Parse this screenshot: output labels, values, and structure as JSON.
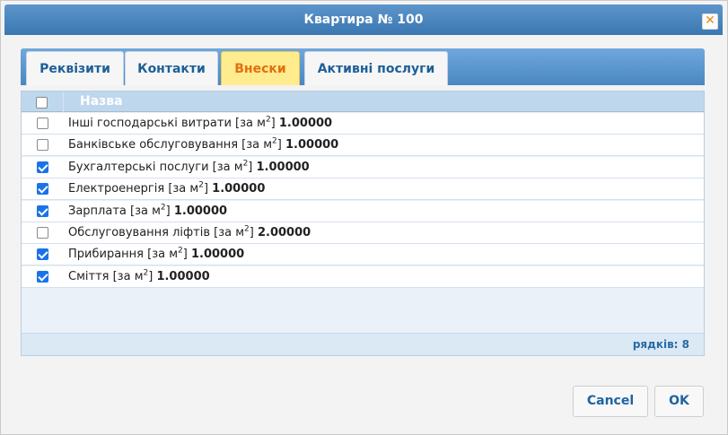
{
  "window": {
    "title": "Квартира № 100",
    "close_icon": "close-icon"
  },
  "tabs": [
    {
      "label": "Реквізити",
      "active": false
    },
    {
      "label": "Контакти",
      "active": false
    },
    {
      "label": "Внески",
      "active": true
    },
    {
      "label": "Активні послуги",
      "active": false
    }
  ],
  "grid": {
    "header": {
      "name": "Назва",
      "select_all_checked": false
    },
    "unit_prefix": "[за м",
    "unit_exp": "2",
    "unit_suffix": "]",
    "rows": [
      {
        "name": "Інші господарські витрати",
        "value": "1.00000",
        "checked": false
      },
      {
        "name": "Банківське обслуговування",
        "value": "1.00000",
        "checked": false
      },
      {
        "name": "Бухгалтерські послуги",
        "value": "1.00000",
        "checked": true
      },
      {
        "name": "Електроенергія",
        "value": "1.00000",
        "checked": true
      },
      {
        "name": "Зарплата",
        "value": "1.00000",
        "checked": true
      },
      {
        "name": "Обслуговування ліфтів",
        "value": "2.00000",
        "checked": false
      },
      {
        "name": "Прибирання",
        "value": "1.00000",
        "checked": true
      },
      {
        "name": "Сміття",
        "value": "1.00000",
        "checked": true
      }
    ],
    "row_count_text": "рядків: 8"
  },
  "buttons": {
    "cancel": "Cancel",
    "ok": "OK"
  },
  "colors": {
    "accent": "#3b77b1",
    "active_tab": "#ffec8f",
    "active_tab_text": "#e46f0e",
    "checkbox": "#1a73e8"
  }
}
